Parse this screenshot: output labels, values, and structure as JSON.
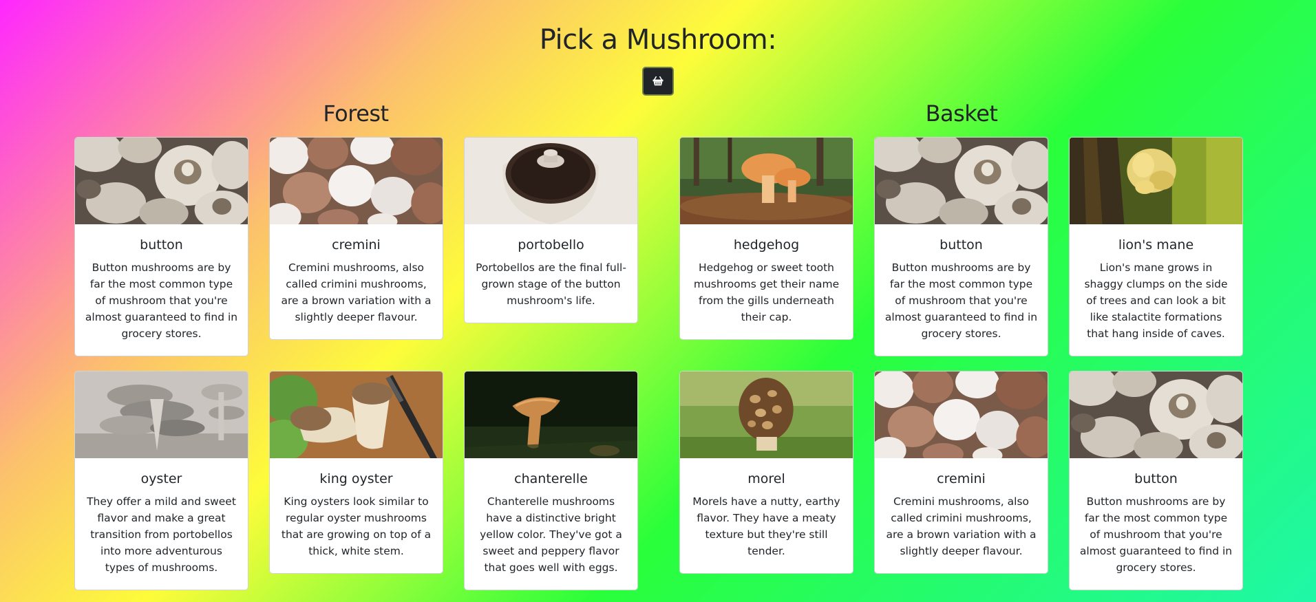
{
  "header": {
    "title": "Pick a Mushroom:"
  },
  "basket_button": {
    "icon": "basket-icon"
  },
  "forest": {
    "heading": "Forest",
    "cards": [
      {
        "name": "button",
        "description": "Button mushrooms are by far the most common type of mushroom that you're almost guaranteed to find in grocery stores."
      },
      {
        "name": "cremini",
        "description": "Cremini mushrooms, also called crimini mushrooms, are a brown variation with a slightly deeper flavour."
      },
      {
        "name": "portobello",
        "description": "Portobellos are the final full-grown stage of the button mushroom's life."
      },
      {
        "name": "oyster",
        "description": "They offer a mild and sweet flavor and make a great transition from portobellos into more adventurous types of mushrooms."
      },
      {
        "name": "king oyster",
        "description": "King oysters look similar to regular oyster mushrooms that are growing on top of a thick, white stem."
      },
      {
        "name": "chanterelle",
        "description": "Chanterelle mushrooms have a distinctive bright yellow color. They've got a sweet and peppery flavor that goes well with eggs."
      }
    ]
  },
  "basket": {
    "heading": "Basket",
    "cards": [
      {
        "name": "hedgehog",
        "description": "Hedgehog or sweet tooth mushrooms get their name from the gills underneath their cap."
      },
      {
        "name": "button",
        "description": "Button mushrooms are by far the most common type of mushroom that you're almost guaranteed to find in grocery stores."
      },
      {
        "name": "lion's mane",
        "description": "Lion's mane grows in shaggy clumps on the side of trees and can look a bit like stalactite formations that hang inside of caves."
      },
      {
        "name": "morel",
        "description": "Morels have a nutty, earthy flavor. They have a meaty texture but they're still tender."
      },
      {
        "name": "cremini",
        "description": "Cremini mushrooms, also called crimini mushrooms, are a brown variation with a slightly deeper flavour."
      },
      {
        "name": "button",
        "description": "Button mushrooms are by far the most common type of mushroom that you're almost guaranteed to find in grocery stores."
      }
    ]
  }
}
